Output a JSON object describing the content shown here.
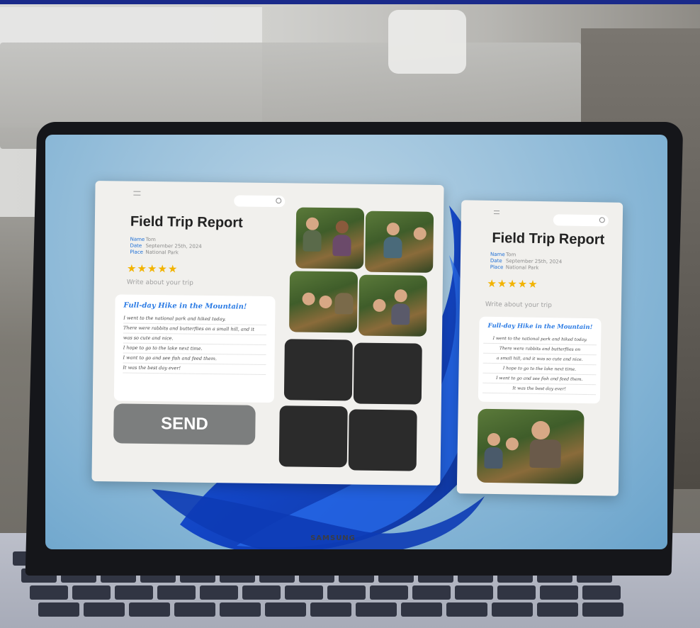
{
  "report": {
    "title": "Field Trip Report",
    "meta": [
      {
        "label": "Name",
        "value": "Tom"
      },
      {
        "label": "Date",
        "value": "September 25th, 2024"
      },
      {
        "label": "Place",
        "value": "National Park"
      }
    ],
    "rating_stars": "★★★★★",
    "prompt": "Write about your trip",
    "note_title": "Full-day Hike in the Mountain!",
    "note_lines": [
      "I went to the national park and hiked today.",
      "There were rabbits and butterflies on a small hill, and it",
      "was so cute and nice.",
      "I hope to go to the lake next time.",
      "I want to go and see fish and feed them.",
      "It was the best day ever!"
    ],
    "send_label": "SEND"
  },
  "phone": {
    "note_lines": [
      "I went to the national park and hiked today.",
      "There were rabbits and butterflies on",
      "a small hill, and it was so cute and nice.",
      "I hope to go to the lake next time.",
      "I want to go and see fish and feed them.",
      "It was the best day ever!"
    ]
  },
  "device": {
    "brand": "SAMSUNG"
  },
  "colors": {
    "accent": "#1e6fd6",
    "star": "#f2b300",
    "send_button": "#7c7e7e"
  }
}
